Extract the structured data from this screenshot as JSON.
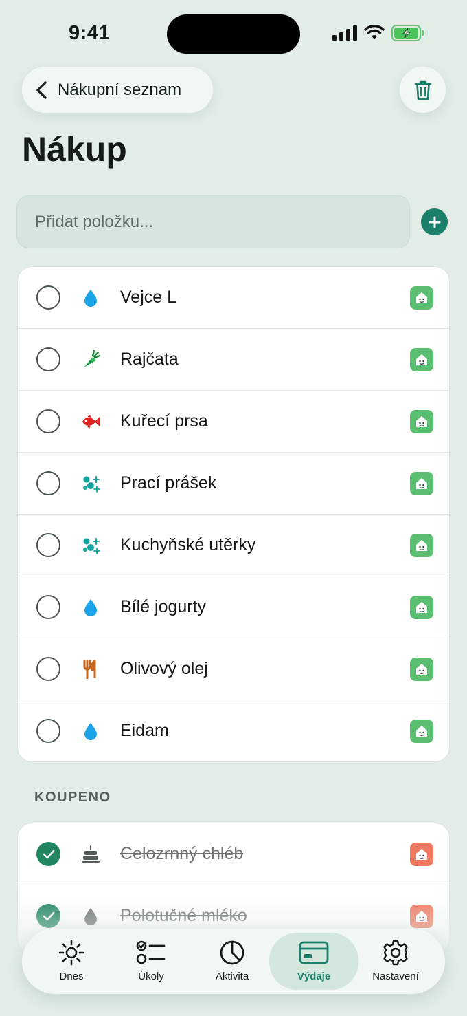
{
  "status": {
    "time": "9:41"
  },
  "nav": {
    "back_label": "Nákupní seznam"
  },
  "page": {
    "title": "Nákup"
  },
  "add": {
    "placeholder": "Přidat položku..."
  },
  "items": [
    {
      "name": "Vejce L",
      "icon": "drop-icon"
    },
    {
      "name": "Rajčata",
      "icon": "carrot-icon"
    },
    {
      "name": "Kuřecí prsa",
      "icon": "fish-icon"
    },
    {
      "name": "Prací prášek",
      "icon": "sparkle-bubbles-icon"
    },
    {
      "name": "Kuchyňské utěrky",
      "icon": "sparkle-bubbles-icon"
    },
    {
      "name": "Bílé jogurty",
      "icon": "drop-icon"
    },
    {
      "name": "Olivový olej",
      "icon": "fork-knife-icon"
    },
    {
      "name": "Eidam",
      "icon": "drop-icon"
    }
  ],
  "bought": {
    "label": "KOUPENO",
    "items": [
      {
        "name": "Celozrnný chléb",
        "icon": "cake-icon"
      },
      {
        "name": "Polotučné mléko",
        "icon": "drop-icon"
      }
    ]
  },
  "tabs": [
    {
      "label": "Dnes",
      "icon": "sun-icon"
    },
    {
      "label": "Úkoly",
      "icon": "checklist-icon"
    },
    {
      "label": "Aktivita",
      "icon": "pie-chart-icon"
    },
    {
      "label": "Výdaje",
      "icon": "card-icon",
      "active": true
    },
    {
      "label": "Nastavení",
      "icon": "gear-icon"
    }
  ],
  "colors": {
    "accent": "#1b7f6a",
    "store_green": "#5bbf72",
    "store_red": "#ef7a62",
    "check_done": "#21855f"
  }
}
